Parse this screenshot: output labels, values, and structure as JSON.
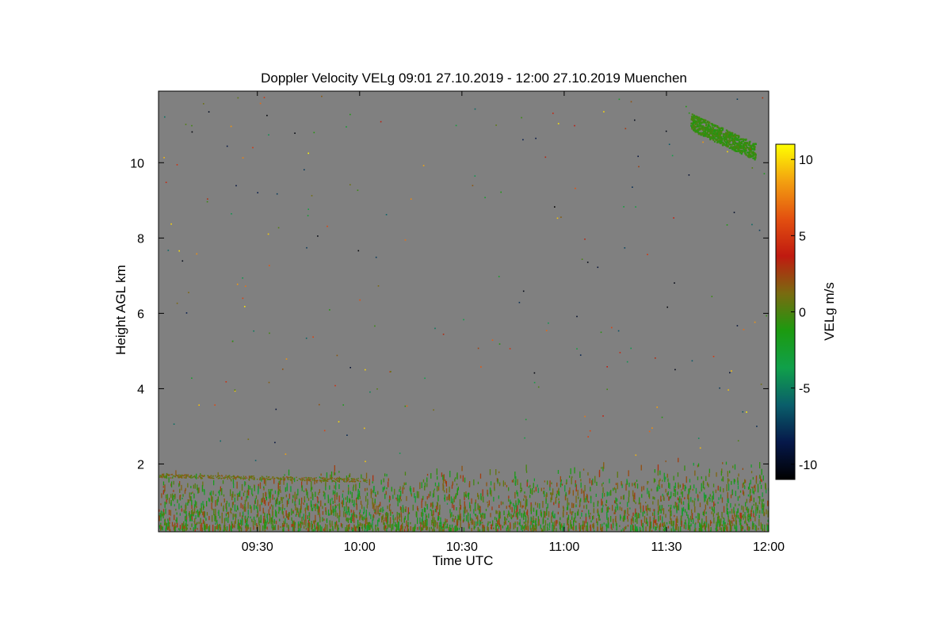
{
  "chart_data": {
    "type": "heatmap",
    "title": "Doppler Velocity VELg   09:01 27.10.2019 - 12:00 27.10.2019 Muenchen",
    "xlabel": "Time UTC",
    "ylabel": "Height AGL km",
    "colorbar_label": "VELg m/s",
    "xlim": [
      "09:01",
      "12:00"
    ],
    "ylim": [
      0.2,
      11.9
    ],
    "x_ticks": [
      "09:30",
      "10:00",
      "10:30",
      "11:00",
      "11:30",
      "12:00"
    ],
    "y_ticks": [
      2,
      4,
      6,
      8,
      10
    ],
    "colorbar_range": [
      -11,
      11
    ],
    "colorbar_ticks": [
      10,
      5,
      0,
      -5,
      -10
    ],
    "colormap": [
      "#000000",
      "#06184a",
      "#0a5e6a",
      "#10a04a",
      "#1c9a10",
      "#7a6a10",
      "#c01a10",
      "#e35010",
      "#f3a010",
      "#ffff00"
    ],
    "background_color": "#808080",
    "grid": false,
    "features": [
      {
        "label": "boundary-layer",
        "height_range_km": [
          0.2,
          2.0
        ],
        "time_range": [
          "09:01",
          "12:00"
        ],
        "velocity_range_ms": [
          -3,
          3
        ]
      },
      {
        "label": "aerosol-layer",
        "height_km": 1.7,
        "time_range": [
          "09:01",
          "10:02"
        ],
        "velocity_ms": 1
      },
      {
        "label": "cirrus-cloud",
        "height_range_km": [
          10.0,
          11.4
        ],
        "time_range": [
          "11:37",
          "11:56"
        ],
        "velocity_ms": -0.5
      }
    ]
  }
}
